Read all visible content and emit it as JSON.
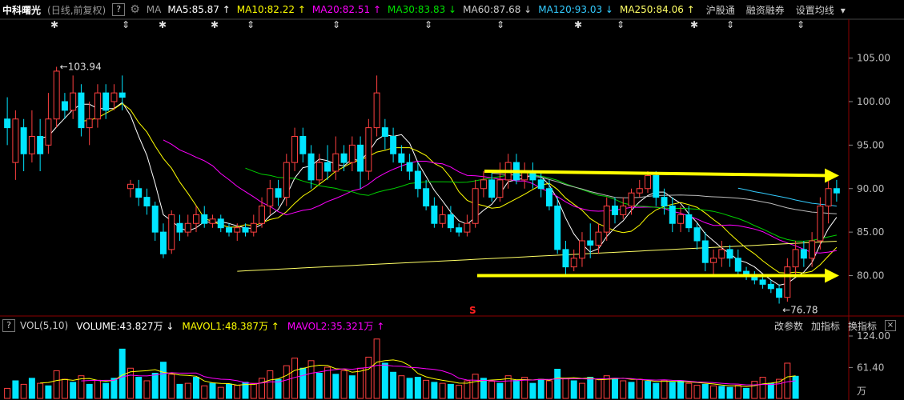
{
  "header": {
    "help_label": "?",
    "stock_name": "中科曙光",
    "period": "(日线,前复权)",
    "help2": "?",
    "ma_label": "MA",
    "ma": [
      {
        "text": "MA5:85.87 ↑",
        "color": "#ffffff"
      },
      {
        "text": "MA10:82.22 ↑",
        "color": "#ffff00"
      },
      {
        "text": "MA20:82.51 ↑",
        "color": "#ff00ff"
      },
      {
        "text": "MA30:83.83 ↓",
        "color": "#00e000"
      },
      {
        "text": "MA60:87.68 ↓",
        "color": "#cccccc"
      },
      {
        "text": "MA120:93.03 ↓",
        "color": "#33ccff"
      },
      {
        "text": "MA250:84.06 ↑",
        "color": "#ffff66"
      }
    ],
    "menu": [
      "沪股通",
      "融资融券",
      "设置均线"
    ],
    "menu_arrow": "▾"
  },
  "event_marks": [
    {
      "sym": "✱"
    },
    {
      "sym": "⇕"
    },
    {
      "sym": "✱"
    },
    {
      "sym": "✱"
    },
    {
      "sym": "⇕"
    },
    {
      "sym": "⇕"
    },
    {
      "sym": "⇕"
    },
    {
      "sym": "⇕"
    },
    {
      "sym": "✱"
    },
    {
      "sym": "⇕"
    },
    {
      "sym": "✱"
    },
    {
      "sym": "⇕"
    },
    {
      "sym": "⇕"
    }
  ],
  "price_axis": [
    "105.00",
    "100.00",
    "95.00",
    "90.00",
    "85.00",
    "80.00"
  ],
  "annotations": {
    "high": "←103.94",
    "low": "←76.78",
    "s_mark": "S"
  },
  "volume_header": {
    "icon": "?",
    "name": "VOL(5,10)",
    "volume": "VOLUME:43.827万 ↓",
    "mavol1": "MAVOL1:48.387万 ↑",
    "mavol2": "MAVOL2:35.321万 ↑",
    "buttons": [
      "改参数",
      "加指标",
      "换指标"
    ],
    "close": "×"
  },
  "volume_axis": [
    "124.00",
    "61.40",
    "万"
  ],
  "colors": {
    "up": "#ff4040",
    "down": "#00e5ff",
    "arrow": "#ffff00"
  },
  "chart_data": {
    "type": "candlestick",
    "price_ylim": [
      76,
      108
    ],
    "candles": [
      [
        98,
        97,
        100.5,
        95
      ],
      [
        93,
        98,
        99,
        91
      ],
      [
        97,
        94,
        98,
        92
      ],
      [
        94,
        96,
        99,
        93
      ],
      [
        96,
        94,
        98,
        92
      ],
      [
        95,
        98,
        101,
        94
      ],
      [
        98,
        103.5,
        104,
        97
      ],
      [
        100,
        99,
        101,
        98
      ],
      [
        99,
        101,
        103,
        98
      ],
      [
        101,
        97,
        102,
        96
      ],
      [
        97,
        98,
        100,
        95
      ],
      [
        98,
        101,
        102,
        97
      ],
      [
        101,
        99,
        102,
        98
      ],
      [
        100,
        101,
        102,
        99
      ],
      [
        101,
        100.5,
        103,
        99
      ],
      [
        90,
        90.5,
        91,
        89
      ],
      [
        90,
        89,
        91,
        88
      ],
      [
        89,
        88,
        90,
        87
      ],
      [
        88,
        85,
        88.5,
        84
      ],
      [
        85,
        82.5,
        86,
        82
      ],
      [
        83,
        87,
        87.5,
        82.5
      ],
      [
        86,
        85,
        87,
        84
      ],
      [
        85,
        86,
        87,
        84.5
      ],
      [
        86,
        87,
        88,
        85
      ],
      [
        87,
        86,
        88,
        85.5
      ],
      [
        86,
        86.5,
        87,
        85.5
      ],
      [
        86.5,
        85.5,
        87,
        85
      ],
      [
        85.5,
        85,
        86,
        84.5
      ],
      [
        85,
        85.5,
        86,
        84
      ],
      [
        85.5,
        85,
        86,
        84.5
      ],
      [
        85,
        86,
        87,
        84.5
      ],
      [
        86,
        88,
        89,
        85.5
      ],
      [
        88,
        90,
        91,
        87
      ],
      [
        90,
        89,
        91,
        88
      ],
      [
        89,
        93,
        94,
        88
      ],
      [
        93,
        96,
        97,
        92
      ],
      [
        96,
        94,
        97,
        93
      ],
      [
        94,
        91,
        95,
        90
      ],
      [
        91,
        93,
        94,
        90.5
      ],
      [
        93,
        92,
        95,
        91
      ],
      [
        92,
        94,
        96,
        91
      ],
      [
        94,
        93,
        95,
        92
      ],
      [
        93,
        95,
        96,
        92
      ],
      [
        95,
        92,
        96,
        90
      ],
      [
        92,
        97,
        98,
        91
      ],
      [
        97,
        101,
        103,
        96
      ],
      [
        97,
        96,
        98,
        94.5
      ],
      [
        96,
        94,
        97,
        93
      ],
      [
        94,
        93,
        95,
        92
      ],
      [
        93,
        92,
        94,
        91
      ],
      [
        92,
        90,
        93,
        89
      ],
      [
        90,
        88,
        91,
        87.5
      ],
      [
        88,
        86,
        89,
        85.5
      ],
      [
        86,
        87,
        88,
        85.5
      ],
      [
        87,
        85.5,
        88,
        85
      ],
      [
        85.5,
        85,
        86,
        84.5
      ],
      [
        85,
        86,
        87,
        84.5
      ],
      [
        86,
        90,
        91,
        85.5
      ],
      [
        90,
        91,
        92,
        89
      ],
      [
        91,
        89,
        92,
        88.5
      ],
      [
        89,
        91,
        93,
        88.5
      ],
      [
        91,
        93,
        94,
        90
      ],
      [
        93,
        91,
        94,
        90.5
      ],
      [
        91,
        92,
        93,
        90
      ],
      [
        92,
        91,
        93,
        90
      ],
      [
        91,
        90,
        92,
        89
      ],
      [
        90,
        88,
        91,
        87.5
      ],
      [
        88,
        83,
        89,
        82.5
      ],
      [
        83,
        81,
        84,
        80
      ],
      [
        81,
        82,
        83,
        80.5
      ],
      [
        82,
        84,
        85,
        81
      ],
      [
        84,
        83.5,
        86,
        82
      ],
      [
        83.5,
        85,
        86,
        82.5
      ],
      [
        85,
        88,
        89,
        84
      ],
      [
        88,
        87,
        89,
        86
      ],
      [
        87,
        88,
        89,
        86.5
      ],
      [
        88,
        89.5,
        90,
        87
      ],
      [
        89.5,
        90,
        91,
        89
      ],
      [
        90,
        91.5,
        92,
        89.5
      ],
      [
        91.5,
        89,
        92,
        88
      ],
      [
        89,
        88,
        90,
        87
      ],
      [
        88,
        86,
        89,
        85
      ],
      [
        86,
        87,
        88,
        85
      ],
      [
        87,
        85.5,
        88,
        85
      ],
      [
        85.5,
        84,
        86,
        83
      ],
      [
        84,
        81.5,
        85,
        80.5
      ],
      [
        81.5,
        82,
        83,
        80
      ],
      [
        82,
        83,
        84,
        81
      ],
      [
        83,
        82,
        83.5,
        81
      ],
      [
        82,
        80.5,
        83,
        80
      ],
      [
        80.5,
        80,
        81,
        79.5
      ],
      [
        80,
        79.5,
        80.5,
        79
      ],
      [
        79.5,
        79,
        80,
        78.5
      ],
      [
        79,
        78.5,
        79.5,
        78
      ],
      [
        78.5,
        77.5,
        79,
        76.78
      ],
      [
        77.5,
        81,
        82,
        77
      ],
      [
        81,
        83,
        84,
        80
      ],
      [
        83,
        82,
        84,
        81
      ],
      [
        82,
        84,
        85,
        81
      ],
      [
        84,
        88,
        89,
        83
      ],
      [
        88,
        90,
        91,
        86
      ],
      [
        90,
        89.5,
        91,
        88.5
      ]
    ],
    "volume_ylim": [
      0,
      124
    ],
    "volumes": [
      [
        20,
        "u"
      ],
      [
        35,
        "d"
      ],
      [
        28,
        "u"
      ],
      [
        40,
        "d"
      ],
      [
        30,
        "u"
      ],
      [
        25,
        "d"
      ],
      [
        55,
        "u"
      ],
      [
        38,
        "u"
      ],
      [
        32,
        "d"
      ],
      [
        45,
        "u"
      ],
      [
        28,
        "d"
      ],
      [
        36,
        "u"
      ],
      [
        30,
        "d"
      ],
      [
        40,
        "d"
      ],
      [
        98,
        "d"
      ],
      [
        60,
        "u"
      ],
      [
        42,
        "d"
      ],
      [
        35,
        "u"
      ],
      [
        50,
        "d"
      ],
      [
        72,
        "d"
      ],
      [
        48,
        "u"
      ],
      [
        28,
        "d"
      ],
      [
        30,
        "u"
      ],
      [
        42,
        "d"
      ],
      [
        25,
        "u"
      ],
      [
        30,
        "d"
      ],
      [
        22,
        "u"
      ],
      [
        28,
        "d"
      ],
      [
        26,
        "u"
      ],
      [
        32,
        "d"
      ],
      [
        30,
        "u"
      ],
      [
        40,
        "u"
      ],
      [
        55,
        "u"
      ],
      [
        38,
        "d"
      ],
      [
        65,
        "u"
      ],
      [
        80,
        "u"
      ],
      [
        60,
        "d"
      ],
      [
        75,
        "u"
      ],
      [
        50,
        "d"
      ],
      [
        62,
        "u"
      ],
      [
        48,
        "d"
      ],
      [
        55,
        "u"
      ],
      [
        45,
        "d"
      ],
      [
        60,
        "u"
      ],
      [
        82,
        "u"
      ],
      [
        118,
        "u"
      ],
      [
        70,
        "d"
      ],
      [
        52,
        "d"
      ],
      [
        45,
        "u"
      ],
      [
        40,
        "d"
      ],
      [
        42,
        "d"
      ],
      [
        36,
        "u"
      ],
      [
        32,
        "d"
      ],
      [
        30,
        "u"
      ],
      [
        28,
        "d"
      ],
      [
        26,
        "u"
      ],
      [
        35,
        "u"
      ],
      [
        48,
        "u"
      ],
      [
        40,
        "d"
      ],
      [
        34,
        "u"
      ],
      [
        30,
        "d"
      ],
      [
        45,
        "u"
      ],
      [
        36,
        "d"
      ],
      [
        42,
        "u"
      ],
      [
        30,
        "d"
      ],
      [
        38,
        "d"
      ],
      [
        35,
        "u"
      ],
      [
        58,
        "d"
      ],
      [
        40,
        "u"
      ],
      [
        35,
        "d"
      ],
      [
        30,
        "u"
      ],
      [
        42,
        "d"
      ],
      [
        38,
        "u"
      ],
      [
        45,
        "u"
      ],
      [
        40,
        "d"
      ],
      [
        35,
        "u"
      ],
      [
        32,
        "d"
      ],
      [
        38,
        "u"
      ],
      [
        34,
        "d"
      ],
      [
        30,
        "d"
      ],
      [
        36,
        "u"
      ],
      [
        32,
        "d"
      ],
      [
        35,
        "d"
      ],
      [
        30,
        "u"
      ],
      [
        26,
        "u"
      ],
      [
        28,
        "d"
      ],
      [
        25,
        "u"
      ],
      [
        24,
        "d"
      ],
      [
        22,
        "d"
      ],
      [
        26,
        "u"
      ],
      [
        20,
        "d"
      ],
      [
        34,
        "u"
      ],
      [
        42,
        "u"
      ],
      [
        30,
        "d"
      ],
      [
        38,
        "u"
      ],
      [
        70,
        "u"
      ],
      [
        44,
        "d"
      ]
    ],
    "arrows": [
      [
        92,
        91.5
      ],
      [
        80,
        80
      ]
    ]
  }
}
